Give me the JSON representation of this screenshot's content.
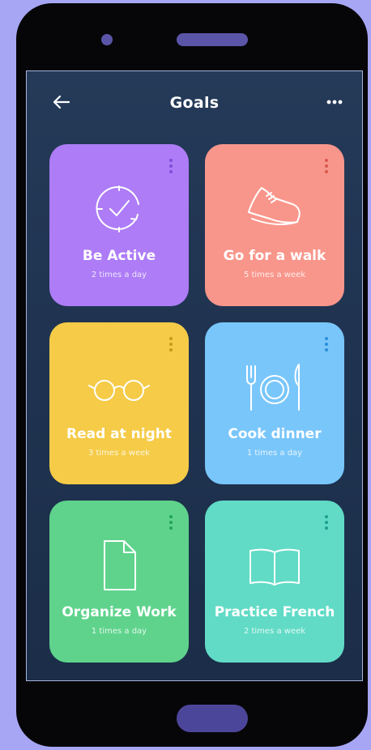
{
  "header": {
    "back_icon": "arrow-left-icon",
    "title": "Goals",
    "more_icon": "more-horizontal-icon"
  },
  "goals": [
    {
      "name": "Be Active",
      "frequency": "2 times a day",
      "icon": "clock-refresh-icon",
      "color": "#ad7cf6",
      "kebab_color": "#7d4ed8"
    },
    {
      "name": "Go for a walk",
      "frequency": "5 times a week",
      "icon": "sneaker-icon",
      "color": "#f9968b",
      "kebab_color": "#d8594e"
    },
    {
      "name": "Read at night",
      "frequency": "3 times a week",
      "icon": "glasses-icon",
      "color": "#f5cb47",
      "kebab_color": "#c99a14"
    },
    {
      "name": "Cook dinner",
      "frequency": "1 times a day",
      "icon": "plate-cutlery-icon",
      "color": "#79c6fb",
      "kebab_color": "#2d8ed8"
    },
    {
      "name": "Organize Work",
      "frequency": "1 times a day",
      "icon": "document-icon",
      "color": "#5fd38c",
      "kebab_color": "#1fa457"
    },
    {
      "name": "Practice French",
      "frequency": "2 times a week",
      "icon": "open-book-icon",
      "color": "#61dbc6",
      "kebab_color": "#1c9f8c"
    }
  ],
  "colors": {
    "page_background": "#a7a6f4",
    "phone_body": "#060608",
    "hardware_accent": "#5b55a8",
    "screen_background": "#213552"
  }
}
